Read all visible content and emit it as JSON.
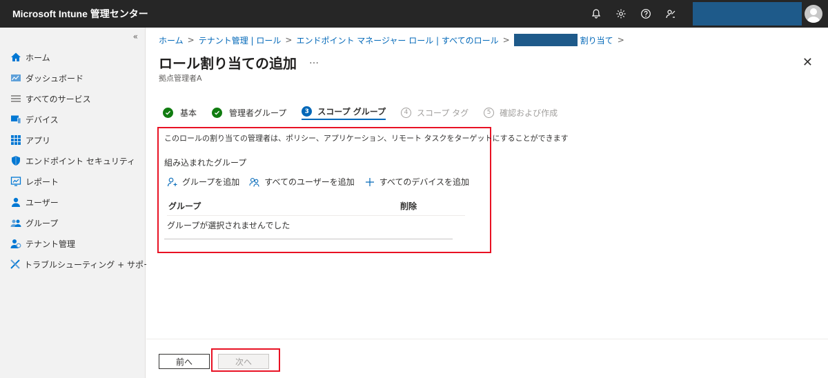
{
  "app": {
    "title": "Microsoft Intune 管理センター"
  },
  "header_icons": [
    "bell-icon",
    "gear-icon",
    "help-icon",
    "feedback-icon"
  ],
  "sidebar": {
    "collapse_label": "«",
    "items": [
      {
        "label": "ホーム",
        "icon": "home-icon"
      },
      {
        "label": "ダッシュボード",
        "icon": "dashboard-icon"
      },
      {
        "label": "すべてのサービス",
        "icon": "list-icon"
      },
      {
        "label": "デバイス",
        "icon": "device-icon"
      },
      {
        "label": "アプリ",
        "icon": "apps-icon"
      },
      {
        "label": "エンドポイント セキュリティ",
        "icon": "shield-icon"
      },
      {
        "label": "レポート",
        "icon": "report-icon"
      },
      {
        "label": "ユーザー",
        "icon": "user-icon"
      },
      {
        "label": "グループ",
        "icon": "group-icon"
      },
      {
        "label": "テナント管理",
        "icon": "tenant-icon"
      },
      {
        "label": "トラブルシューティング + サポート",
        "icon": "tools-icon"
      }
    ]
  },
  "breadcrumb": {
    "items": [
      "ホーム",
      "テナント管理 | ロール",
      "エンドポイント マネージャー ロール | すべてのロール",
      "割り当て"
    ]
  },
  "page": {
    "title": "ロール割り当ての追加",
    "more": "…",
    "subtitle": "拠点管理者A",
    "close": "✕"
  },
  "steps": [
    {
      "label": "基本",
      "state": "done",
      "num": ""
    },
    {
      "label": "管理者グループ",
      "state": "done",
      "num": ""
    },
    {
      "label": "スコープ グループ",
      "state": "active",
      "num": "3"
    },
    {
      "label": "スコープ タグ",
      "state": "inactive",
      "num": "4"
    },
    {
      "label": "確認および作成",
      "state": "inactive",
      "num": "5"
    }
  ],
  "content": {
    "description": "このロールの割り当ての管理者は、ポリシー、アプリケーション、リモート タスクをターゲットにすることができます",
    "section_title": "組み込まれたグループ",
    "actions": {
      "add_group": "グループを追加",
      "add_all_users": "すべてのユーザーを追加",
      "add_all_devices": "すべてのデバイスを追加"
    },
    "table": {
      "col_group": "グループ",
      "col_delete": "削除",
      "empty": "グループが選択されませんでした"
    }
  },
  "footer": {
    "prev": "前へ",
    "next": "次へ"
  },
  "colors": {
    "topbar": "#262626",
    "accent": "#0067b8",
    "success": "#107c10",
    "highlight": "#e81123",
    "redacted": "#1e5a8a"
  }
}
